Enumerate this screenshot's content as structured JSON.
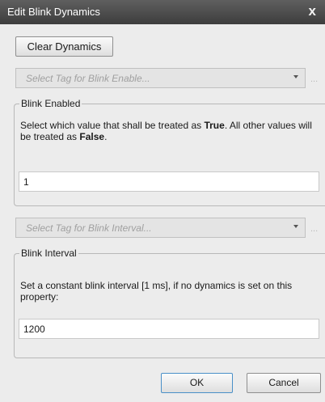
{
  "window": {
    "title": "Edit Blink Dynamics",
    "close_symbol": "x"
  },
  "toolbar": {
    "clear_label": "Clear Dynamics"
  },
  "blink_enable": {
    "tag_placeholder": "Select Tag for Blink Enable...",
    "dots": "...",
    "group_label": "Blink Enabled",
    "description_prefix": "Select which value that shall be treated as ",
    "true_word": "True",
    "description_middle": ". All other values will be treated as ",
    "false_word": "False",
    "description_suffix": ".",
    "value": "1"
  },
  "blink_interval": {
    "tag_placeholder": "Select Tag for Blink Interval...",
    "dots": "...",
    "group_label": "Blink Interval",
    "description": "Set a constant blink interval [1 ms], if no dynamics is set on this property:",
    "value": "1200"
  },
  "footer": {
    "ok_label": "OK",
    "cancel_label": "Cancel"
  }
}
